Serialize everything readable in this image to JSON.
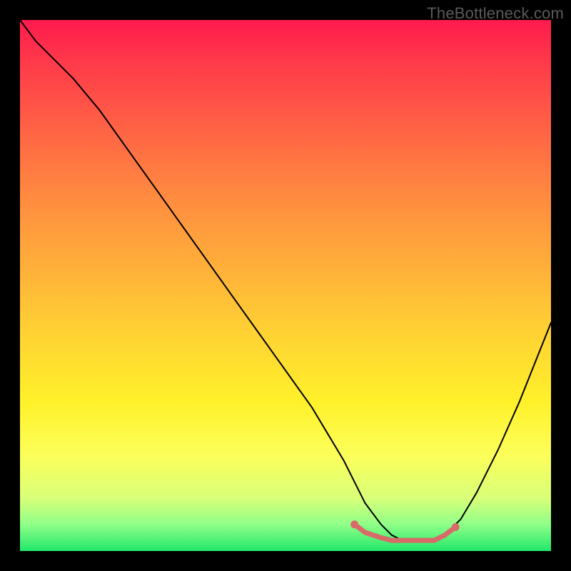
{
  "watermark": "TheBottleneck.com",
  "colors": {
    "background": "#000000",
    "curve": "#000000",
    "marker": "#d86a6a",
    "gradient_top": "#ff1a4e",
    "gradient_bottom": "#22e86b"
  },
  "chart_data": {
    "type": "line",
    "title": "",
    "xlabel": "",
    "ylabel": "",
    "xlim": [
      0,
      100
    ],
    "ylim": [
      0,
      100
    ],
    "grid": false,
    "series": [
      {
        "name": "bottleneck-curve",
        "x": [
          0,
          3,
          6,
          10,
          15,
          20,
          25,
          30,
          35,
          40,
          45,
          50,
          55,
          58,
          61,
          63,
          65,
          68,
          70,
          72,
          74,
          76,
          78,
          80,
          83,
          86,
          90,
          94,
          98,
          100
        ],
        "y": [
          100,
          96,
          93,
          89,
          83,
          76,
          69,
          62,
          55,
          48,
          41,
          34,
          27,
          22,
          17,
          13,
          9,
          5,
          3,
          2,
          2,
          2,
          2,
          3,
          6,
          11,
          19,
          28,
          38,
          43
        ]
      }
    ],
    "highlight_region": {
      "name": "optimal-band",
      "x": [
        63,
        65,
        68,
        70,
        72,
        74,
        76,
        78,
        80,
        82
      ],
      "y": [
        5,
        3.5,
        2.5,
        2,
        2,
        2,
        2,
        2,
        3,
        4.5
      ]
    },
    "annotations": []
  }
}
